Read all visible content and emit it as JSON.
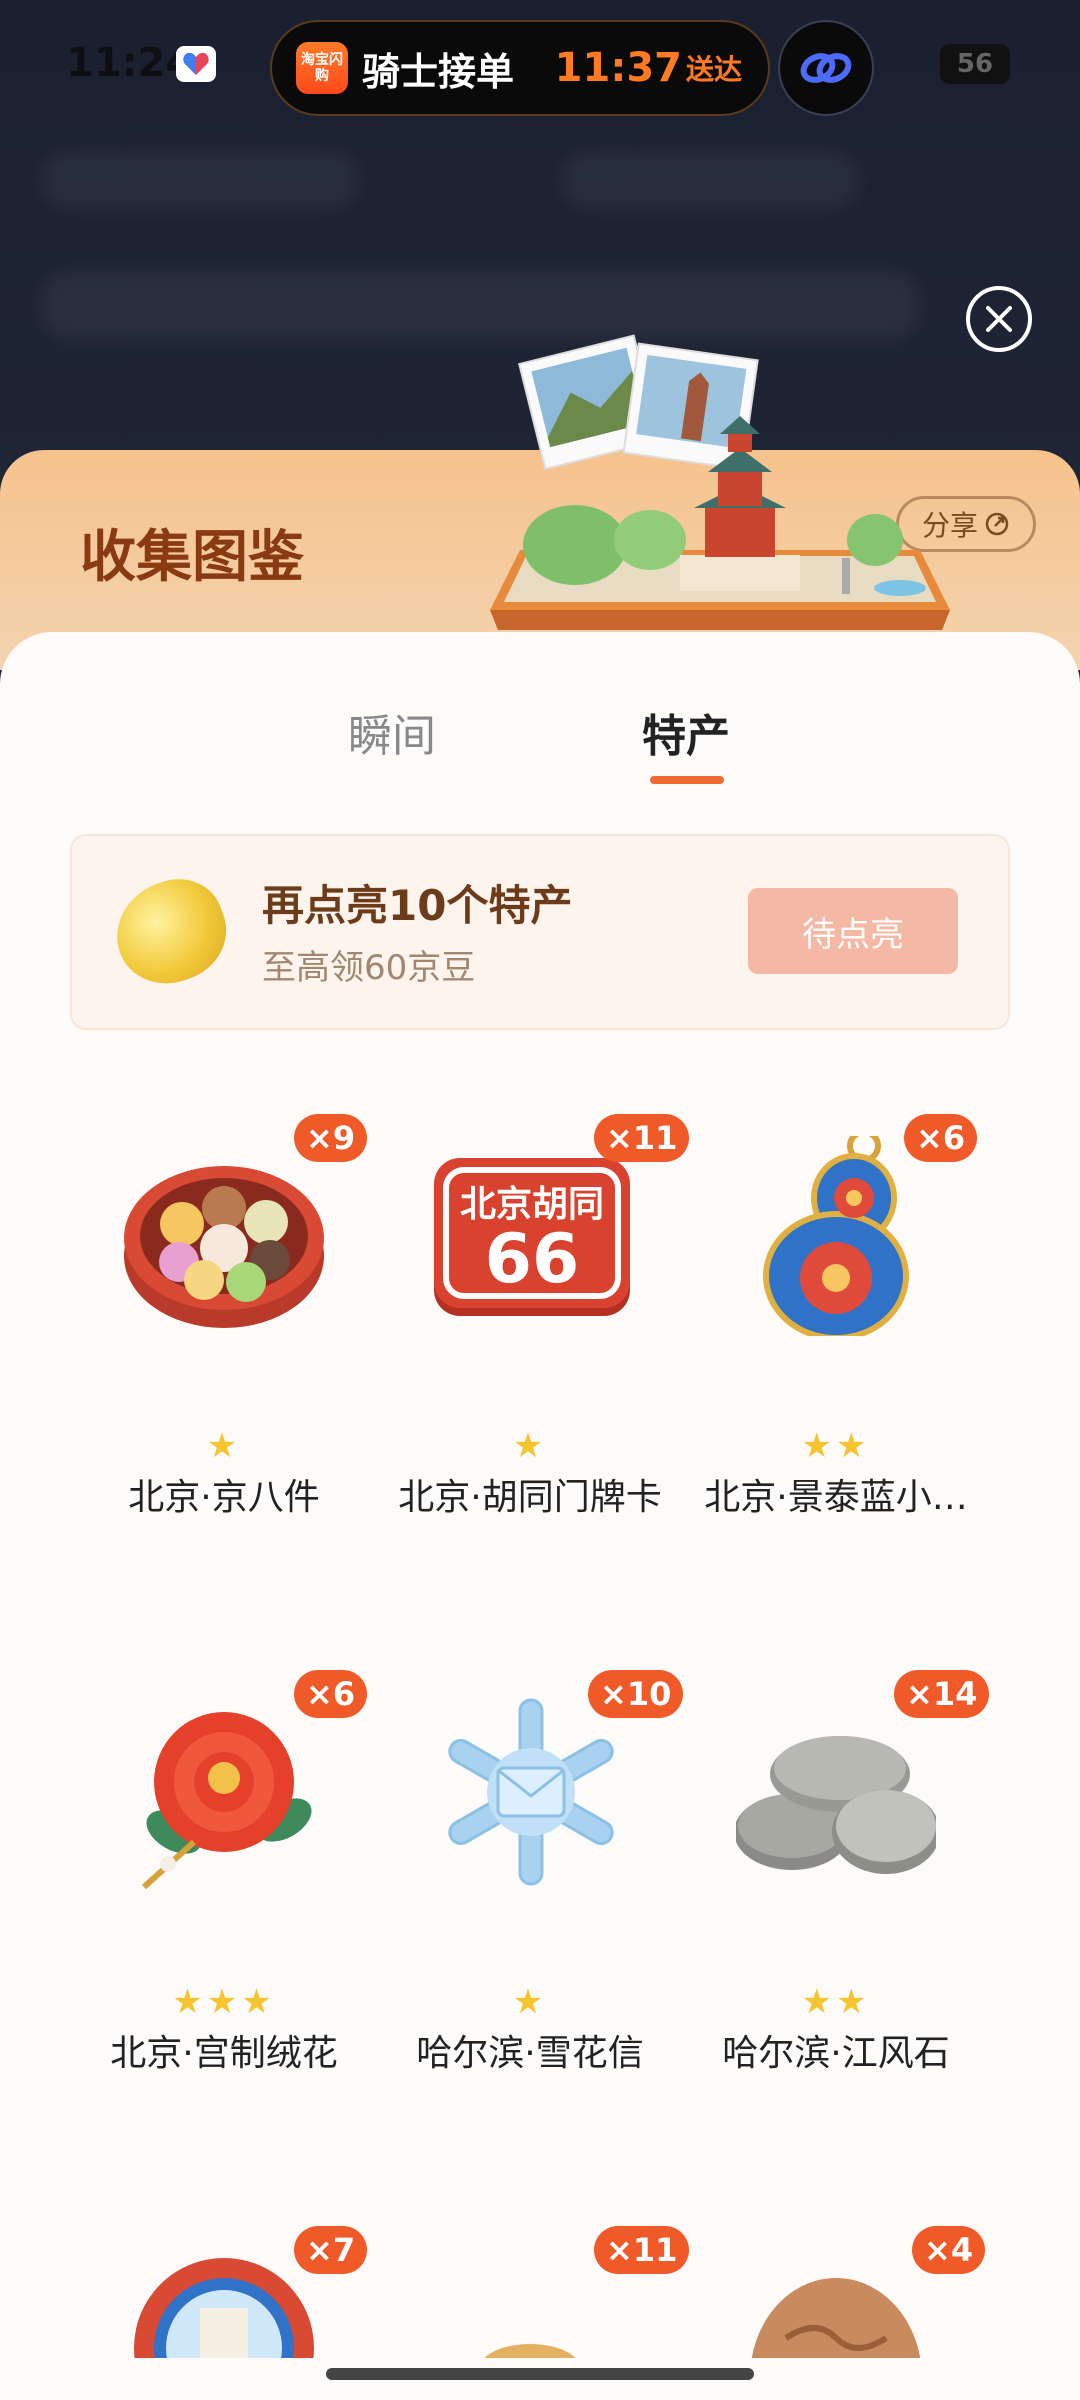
{
  "status": {
    "time": "11:24",
    "battery": "56"
  },
  "island": {
    "app_label": "淘宝闪购",
    "title": "骑士接单",
    "time": "11:37",
    "eta_label": "送达"
  },
  "header": {
    "title": "收集图鉴",
    "share_label": "分享"
  },
  "tabs": [
    {
      "label": "瞬间",
      "active": false
    },
    {
      "label": "特产",
      "active": true
    }
  ],
  "banner": {
    "title": "再点亮10个特产",
    "subtitle": "至高领60京豆",
    "button_label": "待点亮"
  },
  "items": [
    {
      "name": "北京·京八件",
      "count": "×9",
      "stars": "★"
    },
    {
      "name": "北京·胡同门牌卡",
      "count": "×11",
      "stars": "★",
      "plate_top": "北京胡同",
      "plate_num": "66"
    },
    {
      "name": "北京·景泰蓝小…",
      "count": "×6",
      "stars": "★★"
    },
    {
      "name": "北京·宫制绒花",
      "count": "×6",
      "stars": "★★★"
    },
    {
      "name": "哈尔滨·雪花信",
      "count": "×10",
      "stars": "★"
    },
    {
      "name": "哈尔滨·江风石",
      "count": "×14",
      "stars": "★★"
    },
    {
      "name": "",
      "count": "×7",
      "stars": ""
    },
    {
      "name": "",
      "count": "×11",
      "stars": ""
    },
    {
      "name": "",
      "count": "×4",
      "stars": ""
    }
  ],
  "colors": {
    "accent": "#f06a32",
    "badge": "#f05a28",
    "title_brown": "#8a3a10",
    "star": "#f6c42f"
  }
}
